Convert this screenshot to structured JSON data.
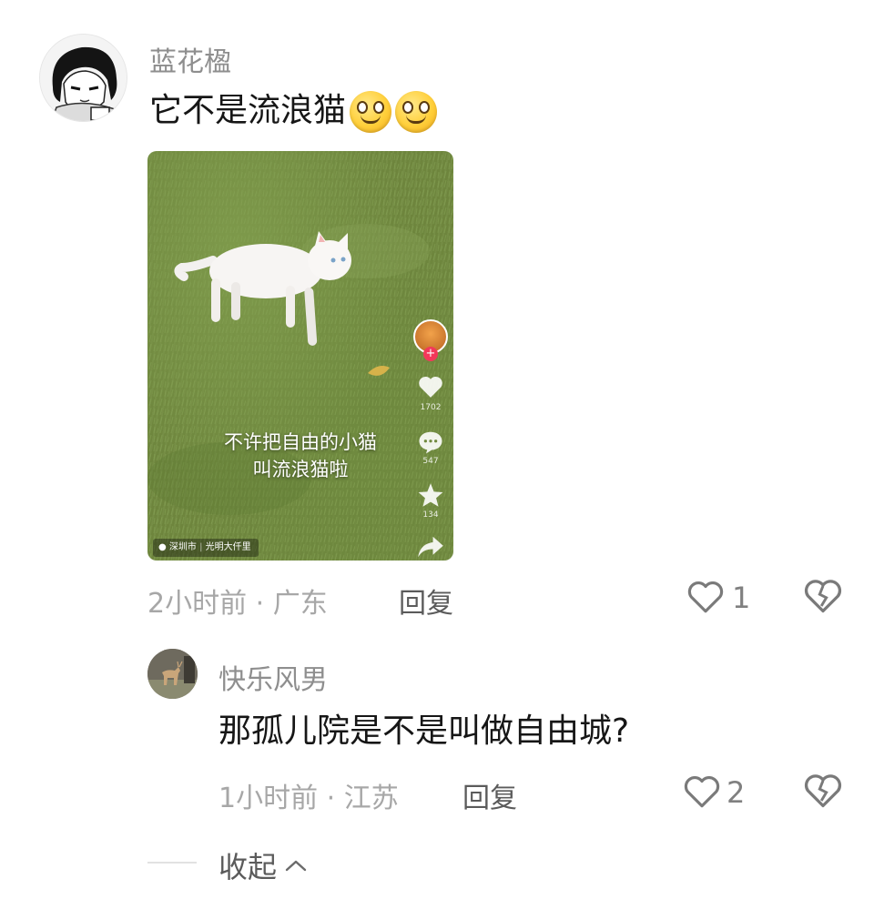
{
  "comment": {
    "username": "蓝花楹",
    "text": "它不是流浪猫",
    "emoji_count": 2,
    "emoji_icon": "smiling-face-icon",
    "video": {
      "caption_line1": "不许把自由的小猫",
      "caption_line2": "叫流浪猫啦",
      "location_city": "深圳市",
      "location_place": "光明大仟里",
      "likes": "1702",
      "comments": "547",
      "favorites": "134"
    },
    "time": "2小时前 · 广东",
    "reply_label": "回复",
    "like_count": "1"
  },
  "reply": {
    "username": "快乐风男",
    "text": "那孤儿院是不是叫做自由城?",
    "time": "1小时前 · 江苏",
    "reply_label": "回复",
    "like_count": "2"
  },
  "collapse_label": "收起",
  "colors": {
    "username": "#8e8e8e",
    "meta": "#a7a7a7",
    "text": "#161616",
    "grass": "#71893f"
  }
}
